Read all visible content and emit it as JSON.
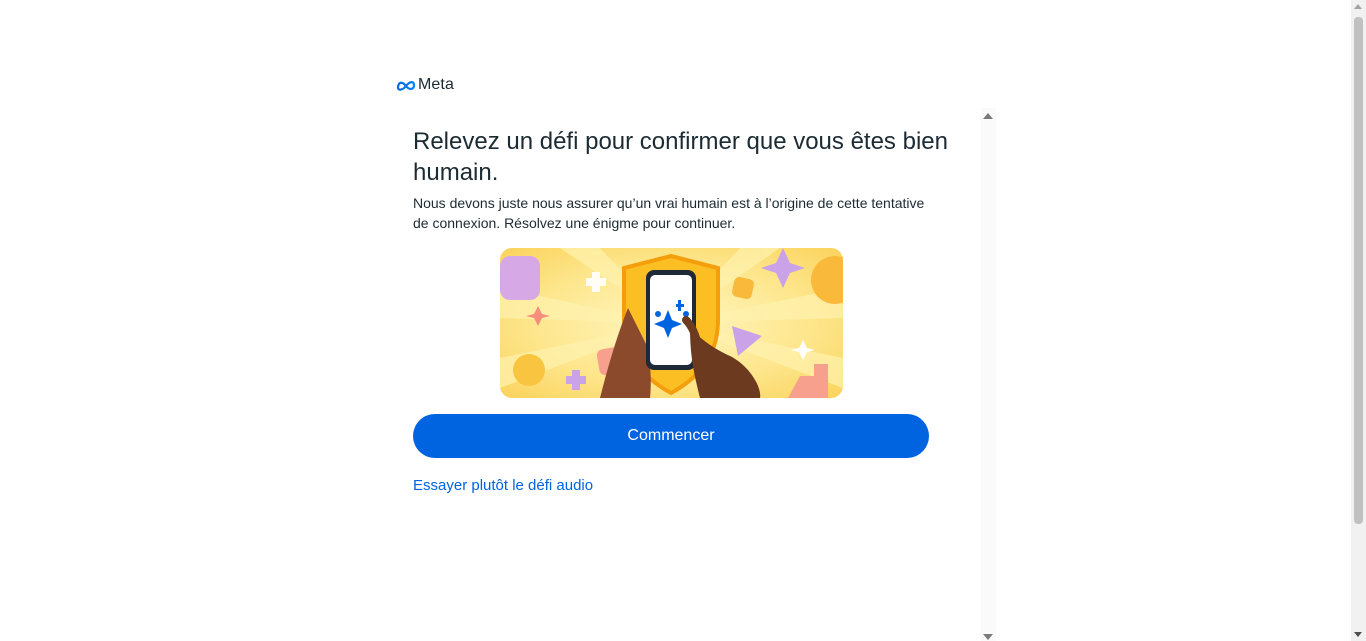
{
  "logo": {
    "text": "Meta",
    "icon": "meta-infinity-icon"
  },
  "challenge": {
    "title": "Relevez un défi pour confirmer que vous êtes bien humain.",
    "description": "Nous devons juste nous assurer qu’un vrai humain est à l’origine de cette tentative de connexion. Résolvez une énigme pour continuer.",
    "illustration_icon": "phone-shield-sparkle-illustration",
    "start_button_label": "Commencer",
    "audio_link_label": "Essayer plutôt le défi audio"
  },
  "colors": {
    "primary": "#0064e0",
    "text": "#1c2b33",
    "illustration_bg": "#fde68a"
  }
}
